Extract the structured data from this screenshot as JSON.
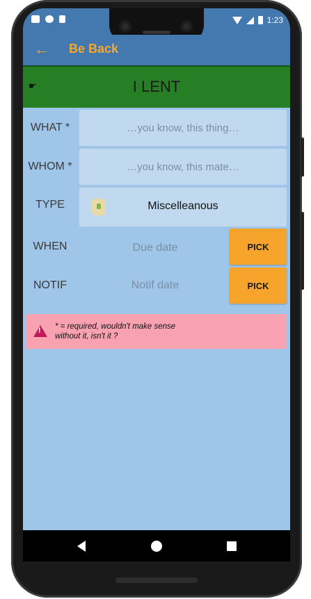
{
  "status_bar": {
    "time": "1:23",
    "icons": [
      "gmail-icon",
      "sync-icon",
      "sim-icon",
      "wifi-icon",
      "signal-icon",
      "battery-icon"
    ]
  },
  "app_bar": {
    "back_icon": "arrow-left-icon",
    "title": "Be Back"
  },
  "banner": {
    "icon": "hand-icon",
    "title": "I LENT"
  },
  "form": {
    "what": {
      "label": "WHAT *",
      "placeholder": "…you know, this thing…"
    },
    "whom": {
      "label": "WHOM *",
      "placeholder": "…you know, this mate…"
    },
    "type": {
      "label": "TYPE",
      "value": "Miscelleanous",
      "icon": "jar-icon"
    },
    "when": {
      "label": "WHEN",
      "placeholder": "Due date",
      "button": "PICK"
    },
    "notif": {
      "label": "NOTIF",
      "placeholder": "Notif date",
      "button": "PICK"
    }
  },
  "warning": {
    "icon": "warning-icon",
    "text_line1": "* = required, wouldn't make sense",
    "text_line2": "without it, isn't it ?"
  },
  "fab": {
    "icon": "check-icon",
    "glyph": "✓"
  },
  "nav": {
    "icons": [
      "back-triangle-icon",
      "home-circle-icon",
      "recents-square-icon"
    ]
  },
  "colors": {
    "primary": "#4479b0",
    "accent": "#f4a72d",
    "banner": "#267f25",
    "background": "#9fc5e8",
    "warning": "#f7a1b1"
  }
}
